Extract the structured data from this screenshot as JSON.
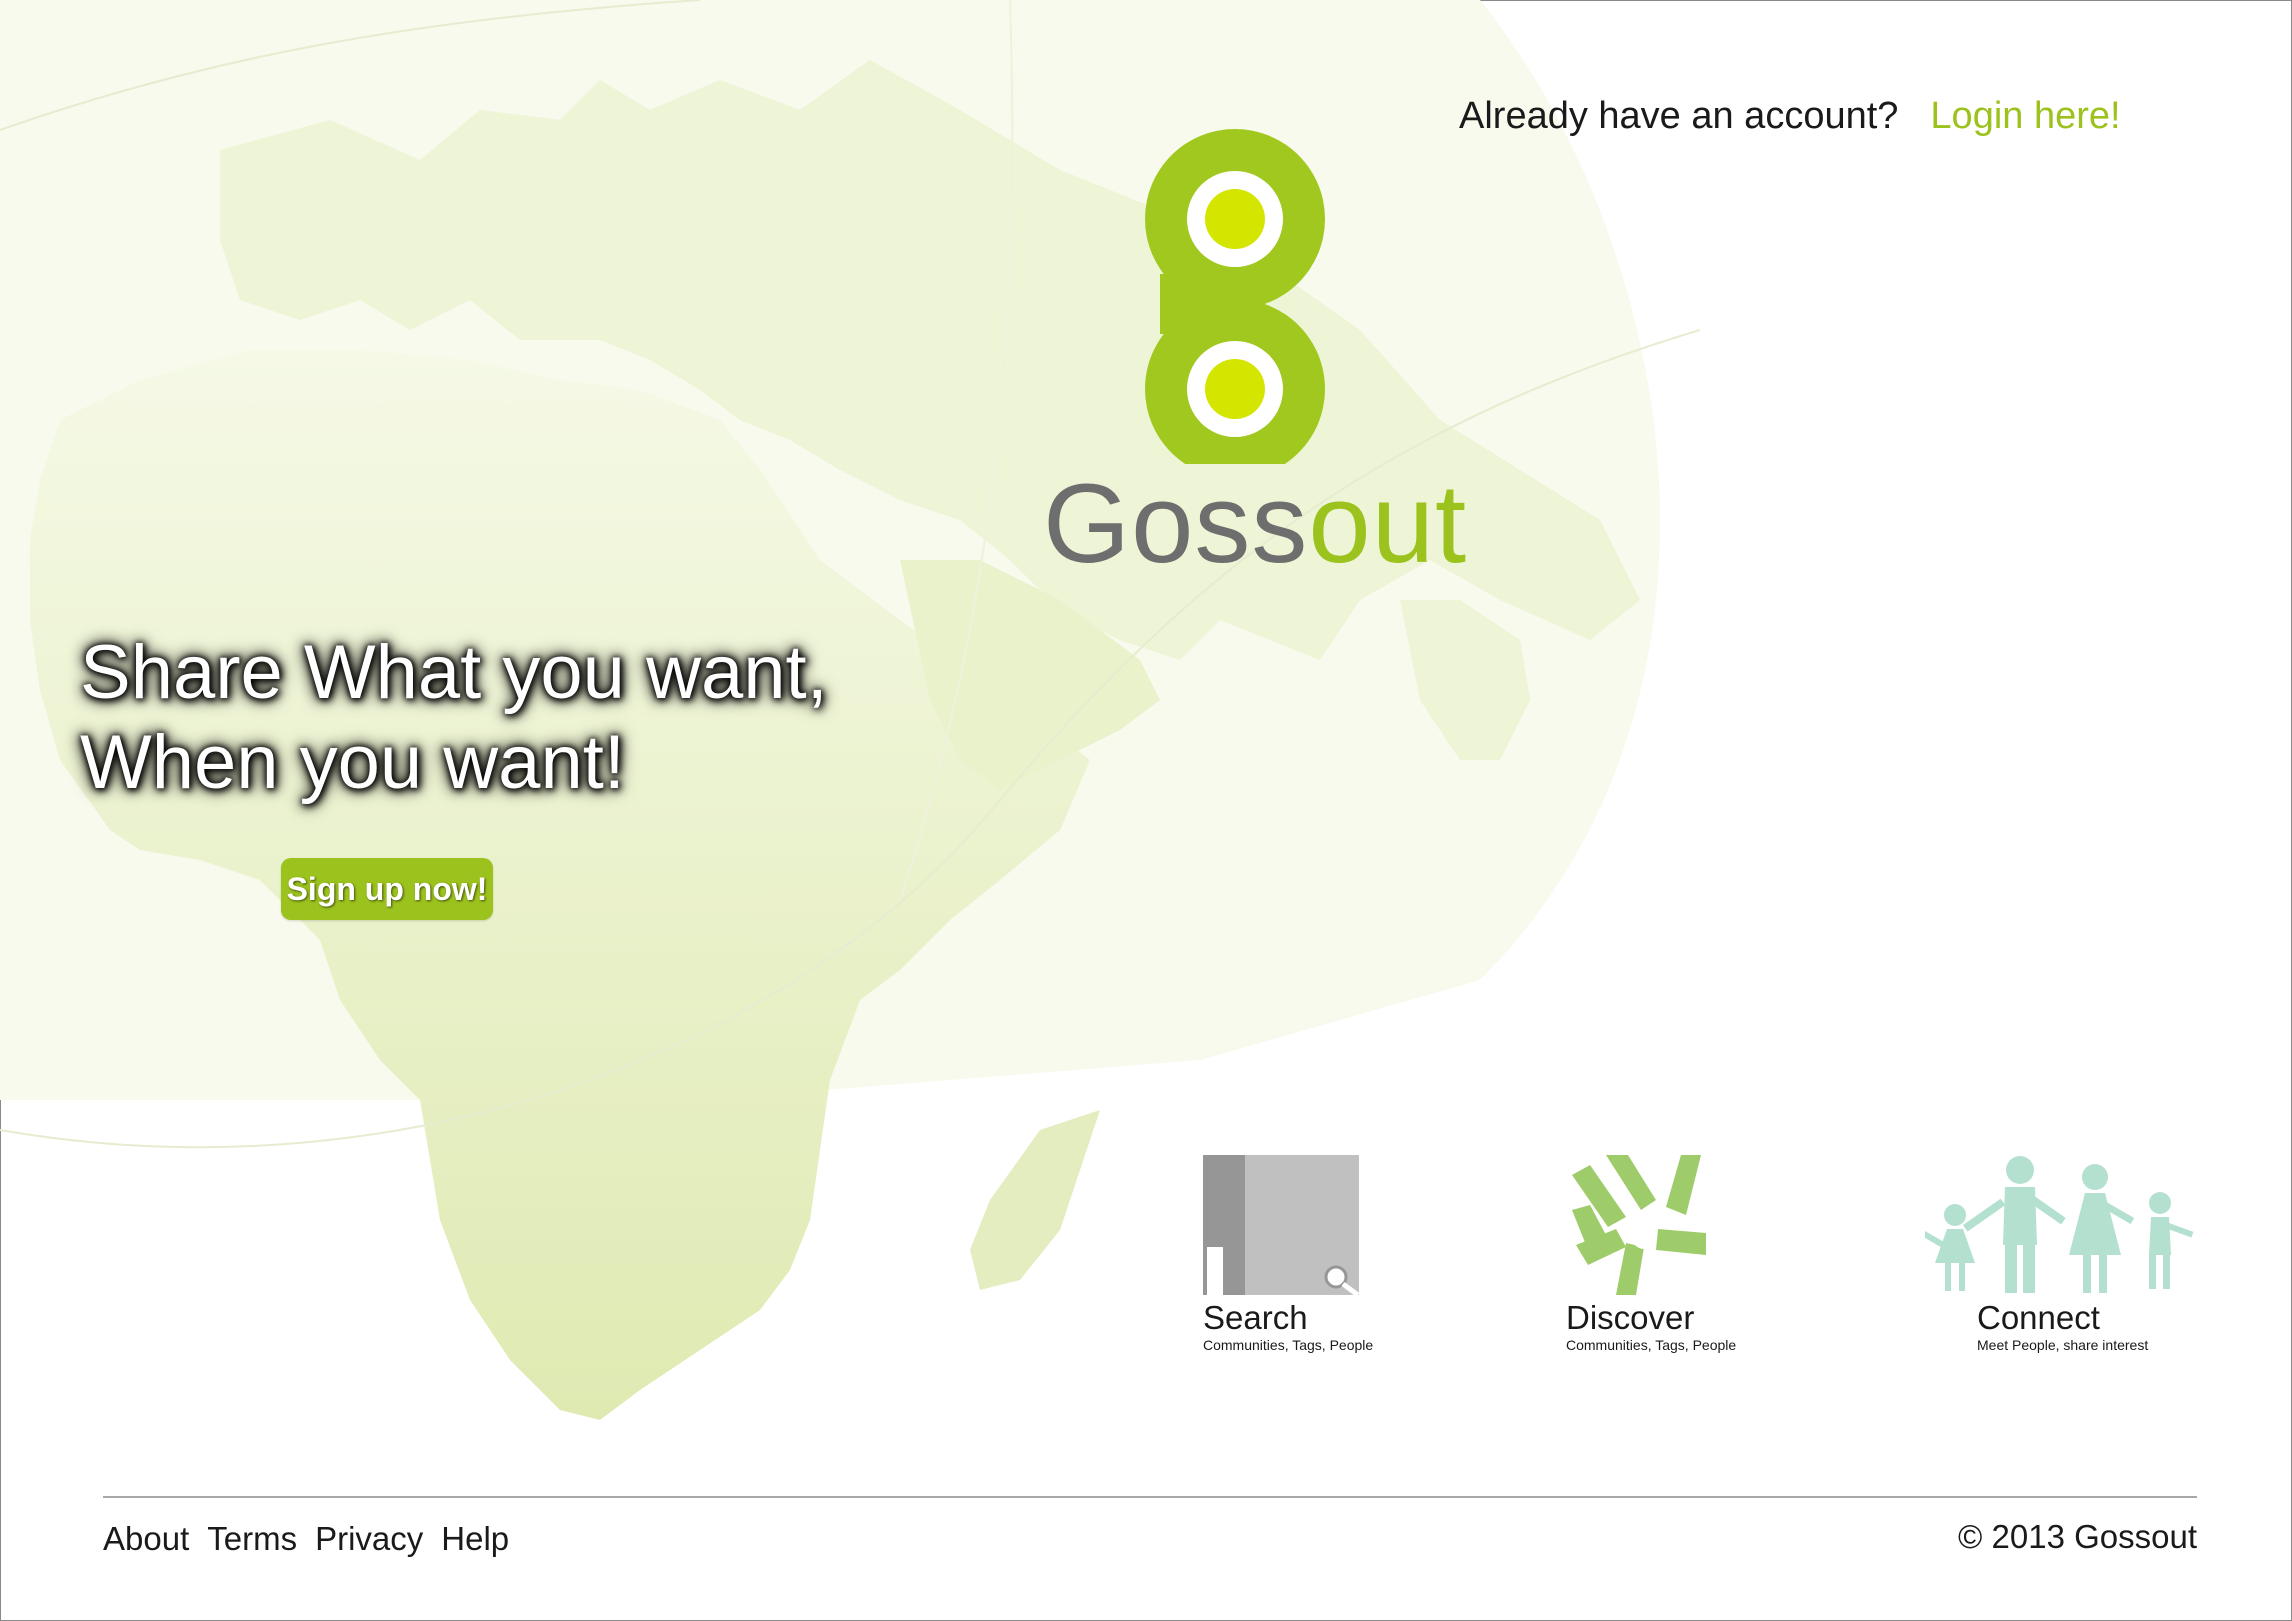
{
  "header": {
    "account_prompt": "Already have an account?",
    "login_link": "Login here!"
  },
  "brand": {
    "name_part1": "Goss",
    "name_part2": "out",
    "primary_color": "#9cc21d",
    "grey_color": "#6e6e6e"
  },
  "hero": {
    "line1": "Share What you want,",
    "line2": "When you want!",
    "signup_button": "Sign up now!"
  },
  "features": [
    {
      "title": "Search",
      "subtitle": "Communities, Tags, People",
      "icon": "search-icon"
    },
    {
      "title": "Discover",
      "subtitle": "Communities, Tags, People",
      "icon": "hands-icon"
    },
    {
      "title": "Connect",
      "subtitle": "Meet People, share interest",
      "icon": "people-icon"
    }
  ],
  "footer": {
    "links": [
      "About",
      "Terms",
      "Privacy",
      "Help"
    ],
    "copyright": "© 2013 Gossout"
  }
}
